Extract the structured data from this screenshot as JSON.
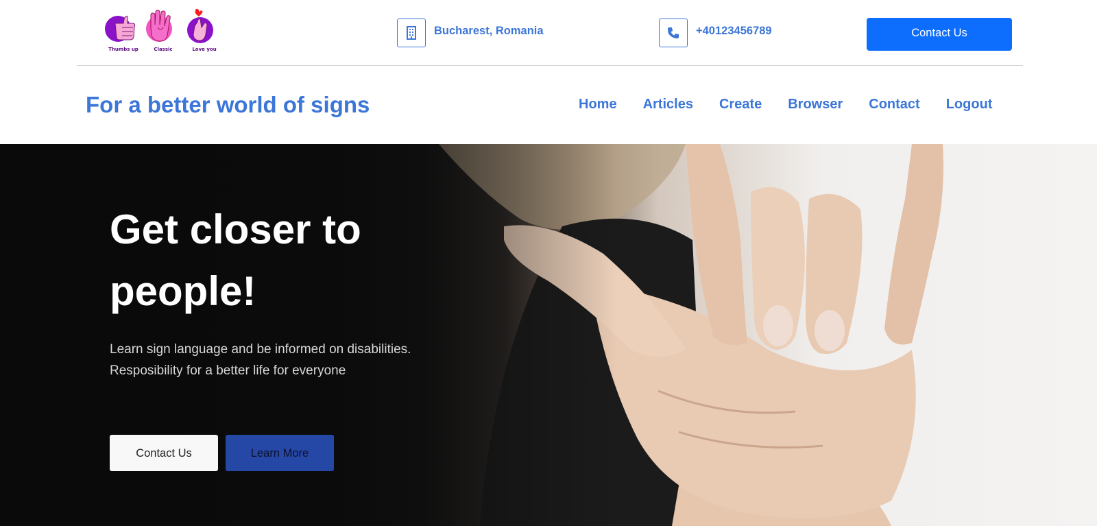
{
  "header": {
    "logos": [
      {
        "caption": "Thumbs up",
        "icon": "thumbs-up-hand-icon"
      },
      {
        "caption": "Classic",
        "icon": "open-hand-icon"
      },
      {
        "caption": "Love you",
        "icon": "finger-heart-icon"
      }
    ],
    "location": {
      "icon": "building-icon",
      "text": "Bucharest, Romania"
    },
    "phone": {
      "icon": "phone-icon",
      "text": "+40123456789"
    },
    "contact_button": "Contact Us"
  },
  "nav": {
    "brand": "For a better world of signs",
    "links": [
      "Home",
      "Articles",
      "Create",
      "Browser",
      "Contact",
      "Logout"
    ]
  },
  "hero": {
    "title_line1": "Get closer to",
    "title_line2": "people!",
    "subtitle_line1": "Learn sign language and be informed on disabilities.",
    "subtitle_line2": "Resposibility for a better life for everyone",
    "contact_button": "Contact Us",
    "learn_button": "Learn More",
    "image": "hand-sign-love-you-photo"
  },
  "colors": {
    "accent": "#3b76d8",
    "primary_button": "#0d6efd",
    "hero_learn_button": "#2547a6",
    "logo_purple": "#8a12c8",
    "logo_pink": "#f055c0"
  }
}
